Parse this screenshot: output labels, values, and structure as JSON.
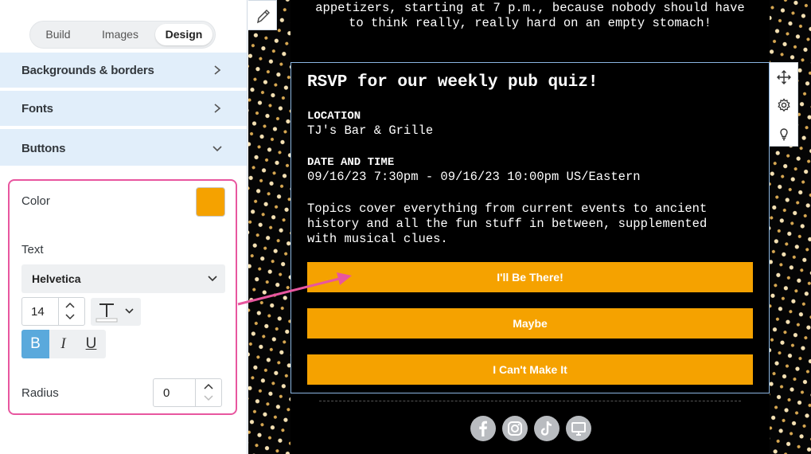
{
  "panel": {
    "tabs": [
      "Build",
      "Images",
      "Design"
    ],
    "active_tab": "Design",
    "sections": [
      {
        "label": "Backgrounds & borders",
        "state": "collapsed"
      },
      {
        "label": "Fonts",
        "state": "collapsed"
      },
      {
        "label": "Buttons",
        "state": "expanded"
      }
    ],
    "buttons": {
      "color_label": "Color",
      "color_value": "#f5a200",
      "text_label": "Text",
      "font": "Helvetica",
      "font_size": "14",
      "bold_label": "B",
      "italic_label": "I",
      "underline_label": "U",
      "bold_active": true,
      "radius_label": "Radius",
      "radius_value": "0"
    }
  },
  "canvas": {
    "intro_line1": "appetizers, starting at 7 p.m., because nobody should have",
    "intro_line2": "to think really, really hard on an empty stomach!",
    "heading": "RSVP for our weekly pub quiz!",
    "location_label": "LOCATION",
    "location_value": "TJ's Bar & Grille",
    "date_label": "DATE AND TIME",
    "date_value": "09/16/23 7:30pm - 09/16/23 10:00pm US/Eastern",
    "desc_line1": "Topics cover everything from current events to ancient",
    "desc_line2": "history and all the fun stuff in between, supplemented",
    "desc_line3": "with musical clues.",
    "rsvp_buttons": [
      "I'll Be There!",
      "Maybe",
      "I Can't Make It"
    ],
    "button_color": "#f5a200",
    "social_icons": [
      "facebook-icon",
      "instagram-icon",
      "tiktok-icon",
      "website-icon"
    ]
  },
  "colors": {
    "highlight": "#e8569f",
    "section_bg": "#e1eefa",
    "accent_blue": "#5aa9dc"
  }
}
